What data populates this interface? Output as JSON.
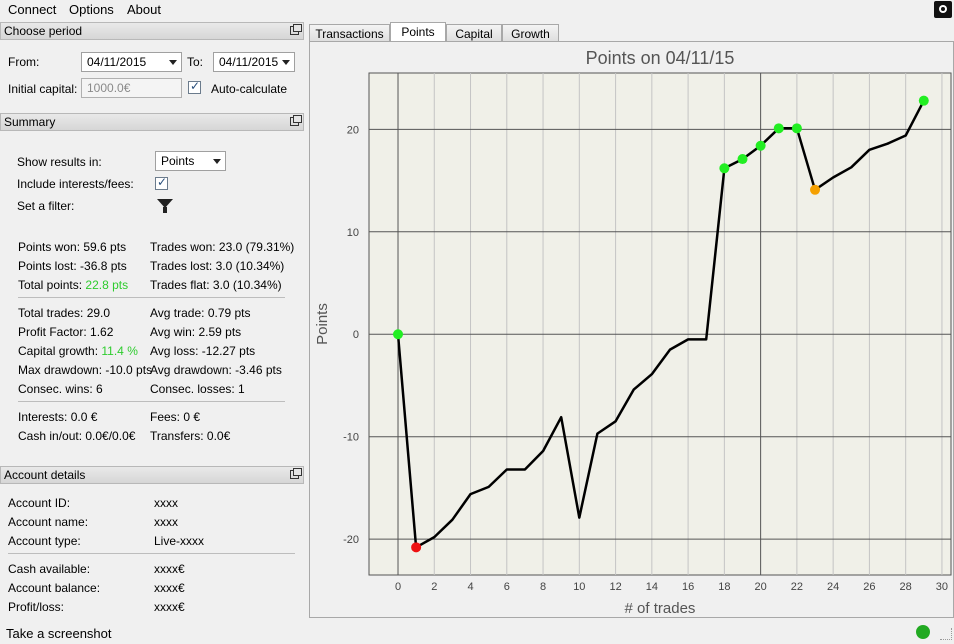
{
  "menu": [
    "Connect",
    "Options",
    "About"
  ],
  "period": {
    "title": "Choose period",
    "from_label": "From:",
    "from_value": "04/11/2015",
    "to_label": "To:",
    "to_value": "04/11/2015",
    "initial_capital_label": "Initial capital:",
    "initial_capital_value": "1000.0€",
    "auto_calc_label": "Auto-calculate"
  },
  "summary": {
    "title": "Summary",
    "show_results_label": "Show results in:",
    "show_results_value": "Points",
    "include_fees_label": "Include interests/fees:",
    "filter_label": "Set a filter:",
    "points_won": "Points won: 59.6 pts",
    "points_lost": "Points lost: -36.8 pts",
    "total_points_label": "Total points:",
    "total_points_value": "22.8 pts",
    "trades_won": "Trades won: 23.0 (79.31%)",
    "trades_lost": "Trades lost: 3.0 (10.34%)",
    "trades_flat": "Trades flat: 3.0 (10.34%)",
    "total_trades": "Total trades: 29.0",
    "profit_factor": "Profit Factor: 1.62",
    "capital_growth_label": "Capital growth:",
    "capital_growth_value": "11.4 %",
    "max_drawdown": "Max drawdown: -10.0 pts",
    "consec_wins": "Consec. wins: 6",
    "avg_trade": "Avg trade: 0.79 pts",
    "avg_win": "Avg win: 2.59 pts",
    "avg_loss": "Avg loss: -12.27 pts",
    "avg_drawdown": "Avg drawdown: -3.46 pts",
    "consec_losses": "Consec. losses: 1",
    "interests": "Interests: 0.0 €",
    "cash_inout": "Cash in/out: 0.0€/0.0€",
    "fees": "Fees: 0 €",
    "transfers": "Transfers: 0.0€"
  },
  "account": {
    "title": "Account details",
    "rows": [
      {
        "label": "Account ID:",
        "value": "xxxx"
      },
      {
        "label": "Account name:",
        "value": "xxxx"
      },
      {
        "label": "Account type:",
        "value": "Live-xxxx"
      },
      {
        "label": "Cash available:",
        "value": "xxxx€"
      },
      {
        "label": "Account balance:",
        "value": "xxxx€"
      },
      {
        "label": "Profit/loss:",
        "value": "xxxx€"
      }
    ]
  },
  "tabs": [
    "Transactions",
    "Points",
    "Capital",
    "Growth"
  ],
  "active_tab": "Points",
  "status_text": "Take a screenshot",
  "colors": {
    "positive": "#2ecc2e",
    "marker_win": "#22ee22",
    "marker_loss": "#ee1111",
    "marker_drop": "#f5a000",
    "status_ok": "#22aa22"
  },
  "chart_data": {
    "type": "line",
    "title": "Points on 04/11/15",
    "xlabel": "# of trades",
    "ylabel": "Points",
    "xlim": [
      -1.6,
      30.5
    ],
    "ylim": [
      -23.5,
      25.5
    ],
    "xticks": [
      0,
      2,
      4,
      6,
      8,
      10,
      12,
      14,
      16,
      18,
      20,
      22,
      24,
      26,
      28,
      30
    ],
    "yticks": [
      -20,
      -10,
      0,
      10,
      20
    ],
    "grid": true,
    "x": [
      0,
      1,
      2,
      3,
      4,
      5,
      6,
      7,
      8,
      9,
      10,
      11,
      12,
      13,
      14,
      15,
      16,
      17,
      18,
      19,
      20,
      21,
      22,
      23,
      24,
      25,
      26,
      27,
      28,
      29
    ],
    "values": [
      0,
      -20.8,
      -19.8,
      -18.1,
      -15.6,
      -14.9,
      -13.2,
      -13.2,
      -11.4,
      -8.1,
      -17.9,
      -9.7,
      -8.5,
      -5.4,
      -3.9,
      -1.5,
      -0.5,
      -0.5,
      16.2,
      17.1,
      18.4,
      20.1,
      20.1,
      14.1,
      15.3,
      16.3,
      18.0,
      18.6,
      19.4,
      22.8
    ],
    "markers": [
      {
        "x": 0,
        "y": 0,
        "kind": "win"
      },
      {
        "x": 1,
        "y": -20.8,
        "kind": "loss"
      },
      {
        "x": 18,
        "y": 16.2,
        "kind": "win"
      },
      {
        "x": 19,
        "y": 17.1,
        "kind": "win"
      },
      {
        "x": 20,
        "y": 18.4,
        "kind": "win"
      },
      {
        "x": 21,
        "y": 20.1,
        "kind": "win"
      },
      {
        "x": 22,
        "y": 20.1,
        "kind": "win"
      },
      {
        "x": 23,
        "y": 14.1,
        "kind": "drop"
      },
      {
        "x": 29,
        "y": 22.8,
        "kind": "win"
      }
    ]
  }
}
